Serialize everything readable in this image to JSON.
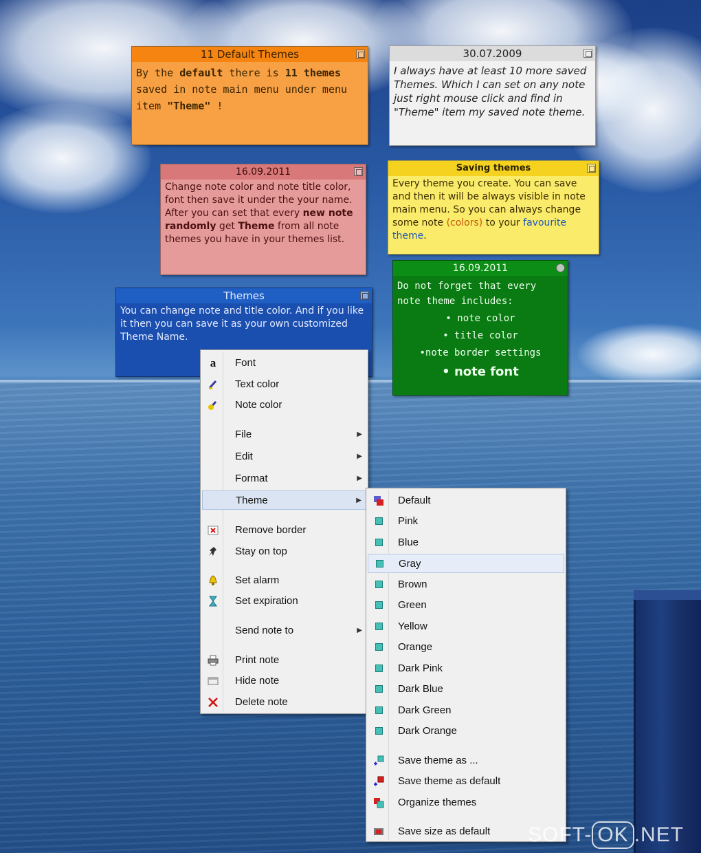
{
  "notes": {
    "orange": {
      "title": "11 Default Themes",
      "t1": "By the ",
      "b1": "default",
      "t2": " there is ",
      "b2": "11 themes",
      "t3": " saved in note main menu under menu item ",
      "b3": "\"Theme\"",
      "t4": " !"
    },
    "gray": {
      "title": "30.07.2009",
      "text": "I always have at least 10 more saved Themes. Which I can set on any note just right mouse click and find in \"Theme\" item my saved note theme."
    },
    "pink": {
      "title": "16.09.2011",
      "t1": "Change note color and note title color, font then save it under the your name. After you can set that every ",
      "b1": "new note randomly",
      "t2": " get ",
      "b2": "Theme",
      "t3": " from all note themes you have in your themes list."
    },
    "yellow": {
      "title": "Saving themes",
      "t1": "Every theme you create. You can save and then it will be always visible in note main menu. So you can always change some note ",
      "orange": "(colors)",
      "t2": " to your ",
      "blue": "favourite theme",
      "t3": "."
    },
    "blue": {
      "title": "Themes",
      "text": "You can change note and title color. And if you like it then you can save it as your own customized Theme Name."
    },
    "green": {
      "title": "16.09.2011",
      "intro": "Do not forget that every note theme includes:",
      "items": [
        "• note color",
        "• title color",
        "•note border settings",
        "• note font"
      ]
    }
  },
  "context_menu": {
    "items": [
      {
        "label": "Font",
        "icon": "font-icon"
      },
      {
        "label": "Text color",
        "icon": "text-color-icon"
      },
      {
        "label": "Note color",
        "icon": "note-color-icon"
      },
      {
        "label": "File",
        "submenu": true
      },
      {
        "label": "Edit",
        "submenu": true
      },
      {
        "label": "Format",
        "submenu": true
      },
      {
        "label": "Theme",
        "submenu": true,
        "highlighted": true
      },
      {
        "label": "Remove border",
        "icon": "remove-border-icon"
      },
      {
        "label": "Stay on top",
        "icon": "pin-icon"
      },
      {
        "label": "Set alarm",
        "icon": "bell-icon"
      },
      {
        "label": "Set expiration",
        "icon": "hourglass-icon"
      },
      {
        "label": "Send note to",
        "submenu": true
      },
      {
        "label": "Print note",
        "icon": "printer-icon"
      },
      {
        "label": "Hide note",
        "icon": "hide-icon"
      },
      {
        "label": "Delete note",
        "icon": "delete-icon"
      }
    ]
  },
  "theme_menu": {
    "items": [
      "Default",
      "Pink",
      "Blue",
      "Gray",
      "Brown",
      "Green",
      "Yellow",
      "Orange",
      "Dark Pink",
      "Dark Blue",
      "Dark Green",
      "Dark Orange",
      "Save theme as ...",
      "Save theme as default",
      "Organize themes",
      "Save size as default"
    ],
    "highlighted": "Gray"
  },
  "watermark": {
    "left": "SOFT-",
    "box": "OK",
    "right": ".NET"
  },
  "colors": {
    "menu_highlight": "#dbe4f3",
    "theme_icon": "#44c0b8"
  }
}
